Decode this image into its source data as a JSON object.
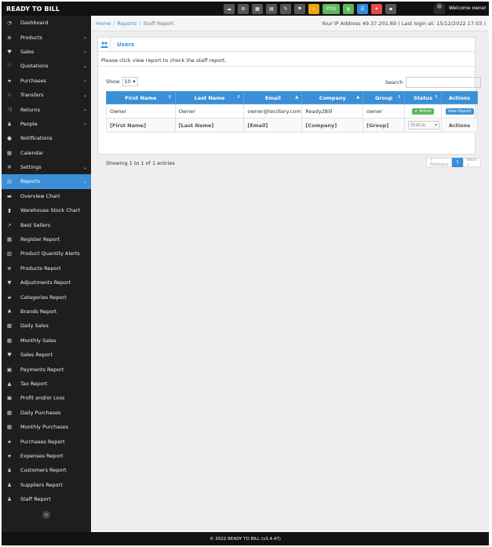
{
  "brand": "READY TO BILL",
  "topbar": {
    "buttons": [
      {
        "name": "dashboard-icon",
        "glyph": "☁",
        "color": "gray"
      },
      {
        "name": "settings-icon",
        "glyph": "⚙",
        "color": "gray"
      },
      {
        "name": "calculator-icon",
        "glyph": "▦",
        "color": "gray"
      },
      {
        "name": "calendar-icon",
        "glyph": "▤",
        "color": "gray"
      },
      {
        "name": "edit-icon",
        "glyph": "✎",
        "color": "gray"
      },
      {
        "name": "language-flag-icon",
        "glyph": "⚑",
        "color": "gray"
      },
      {
        "name": "alert-icon",
        "glyph": "⚠",
        "color": "orange"
      },
      {
        "name": "pos-button",
        "label": "POS",
        "color": "green"
      },
      {
        "name": "hourglass-icon",
        "glyph": "⧗",
        "color": "green"
      },
      {
        "name": "list-icon",
        "glyph": "☰",
        "color": "blue"
      },
      {
        "name": "magic-icon",
        "glyph": "✦",
        "color": "red"
      },
      {
        "name": "menu-icon",
        "glyph": "▪",
        "color": "gray"
      }
    ],
    "welcome": "Welcome owner"
  },
  "sidebar": {
    "items": [
      {
        "label": "Dashboard",
        "icon": "dashboard-icon",
        "glyph": "◔",
        "chevron": false
      },
      {
        "label": "Products",
        "icon": "barcode-icon",
        "glyph": "≣",
        "chevron": true
      },
      {
        "label": "Sales",
        "icon": "heart-icon",
        "glyph": "♥",
        "chevron": true
      },
      {
        "label": "Quotations",
        "icon": "heart-outline-icon",
        "glyph": "♡",
        "chevron": true
      },
      {
        "label": "Purchases",
        "icon": "star-icon",
        "glyph": "★",
        "chevron": true
      },
      {
        "label": "Transfers",
        "icon": "star-outline-icon",
        "glyph": "☆",
        "chevron": true
      },
      {
        "label": "Returns",
        "icon": "random-icon",
        "glyph": "⤨",
        "chevron": true
      },
      {
        "label": "People",
        "icon": "users-icon",
        "glyph": "♟",
        "chevron": true
      },
      {
        "label": "Notifications",
        "icon": "info-icon",
        "glyph": "●",
        "chevron": false
      },
      {
        "label": "Calendar",
        "icon": "calendar-icon",
        "glyph": "▦",
        "chevron": false
      },
      {
        "label": "Settings",
        "icon": "cog-icon",
        "glyph": "✲",
        "chevron": true
      },
      {
        "label": "Reports",
        "icon": "bar-chart-icon",
        "glyph": "▥",
        "chevron": true,
        "active": true
      },
      {
        "label": "Overview Chart",
        "icon": "bar-chart-icon",
        "glyph": "▬",
        "sub": true
      },
      {
        "label": "Warehouse Stock Chart",
        "icon": "building-icon",
        "glyph": "▮",
        "sub": true
      },
      {
        "label": "Best Sellers",
        "icon": "line-chart-icon",
        "glyph": "↗",
        "sub": true
      },
      {
        "label": "Register Report",
        "icon": "th-icon",
        "glyph": "▦",
        "sub": true
      },
      {
        "label": "Product Quantity Alerts",
        "icon": "bar-chart-icon",
        "glyph": "▥",
        "sub": true
      },
      {
        "label": "Products Report",
        "icon": "barcode-icon",
        "glyph": "≣",
        "sub": true
      },
      {
        "label": "Adjustments Report",
        "icon": "filter-icon",
        "glyph": "▼",
        "sub": true
      },
      {
        "label": "Categories Report",
        "icon": "folder-icon",
        "glyph": "▰",
        "sub": true
      },
      {
        "label": "Brands Report",
        "icon": "cubes-icon",
        "glyph": "♣",
        "sub": true
      },
      {
        "label": "Daily Sales",
        "icon": "calendar-icon",
        "glyph": "▦",
        "sub": true
      },
      {
        "label": "Monthly Sales",
        "icon": "calendar-icon",
        "glyph": "▦",
        "sub": true
      },
      {
        "label": "Sales Report",
        "icon": "heart-icon",
        "glyph": "♥",
        "sub": true
      },
      {
        "label": "Payments Report",
        "icon": "money-icon",
        "glyph": "▣",
        "sub": true
      },
      {
        "label": "Tax Report",
        "icon": "area-chart-icon",
        "glyph": "▲",
        "sub": true
      },
      {
        "label": "Profit and/or Loss",
        "icon": "money-icon",
        "glyph": "▣",
        "sub": true
      },
      {
        "label": "Daily Purchases",
        "icon": "calendar-icon",
        "glyph": "▦",
        "sub": true
      },
      {
        "label": "Monthly Purchases",
        "icon": "calendar-icon",
        "glyph": "▦",
        "sub": true
      },
      {
        "label": "Purchases Report",
        "icon": "star-icon",
        "glyph": "★",
        "sub": true
      },
      {
        "label": "Expenses Report",
        "icon": "star-icon",
        "glyph": "★",
        "sub": true
      },
      {
        "label": "Customers Report",
        "icon": "users-icon",
        "glyph": "♟",
        "sub": true
      },
      {
        "label": "Suppliers Report",
        "icon": "users-icon",
        "glyph": "♟",
        "sub": true
      },
      {
        "label": "Staff Report",
        "icon": "users-icon",
        "glyph": "♟",
        "sub": true
      }
    ],
    "collapse_glyph": "«"
  },
  "breadcrumb": {
    "home": "Home",
    "reports": "Reports",
    "current": "Staff Report",
    "separator": "/"
  },
  "ip_info": "Your IP Address 49.37.201.89 ( Last login at: 15/12/2022 17:03 )",
  "box": {
    "title": "Users",
    "intro": "Please click view report to check the staff report."
  },
  "table_controls": {
    "show_label": "Show",
    "show_value": "10",
    "search_label": "Search"
  },
  "table": {
    "columns": [
      "First Name",
      "Last Name",
      "Email",
      "Company",
      "Group",
      "Status",
      "Actions"
    ],
    "rows": [
      {
        "first": "Owner",
        "last": "Owner",
        "email": "owner@tecdiary.com",
        "company": "Ready2Bill",
        "group": "owner",
        "status": "✔ Active",
        "action": "View Report"
      }
    ],
    "filters": {
      "first": "[First Name]",
      "last": "[Last Name]",
      "email": "[Email]",
      "company": "[Company]",
      "group": "[Group]",
      "status": "Status",
      "actions": "Actions"
    }
  },
  "pagination": {
    "info": "Showing 1 to 1 of 1 entries",
    "previous": "« Previous",
    "current": "1",
    "next": "Next »"
  },
  "footer": "© 2022 READY TO BILL (v3.4.47)"
}
